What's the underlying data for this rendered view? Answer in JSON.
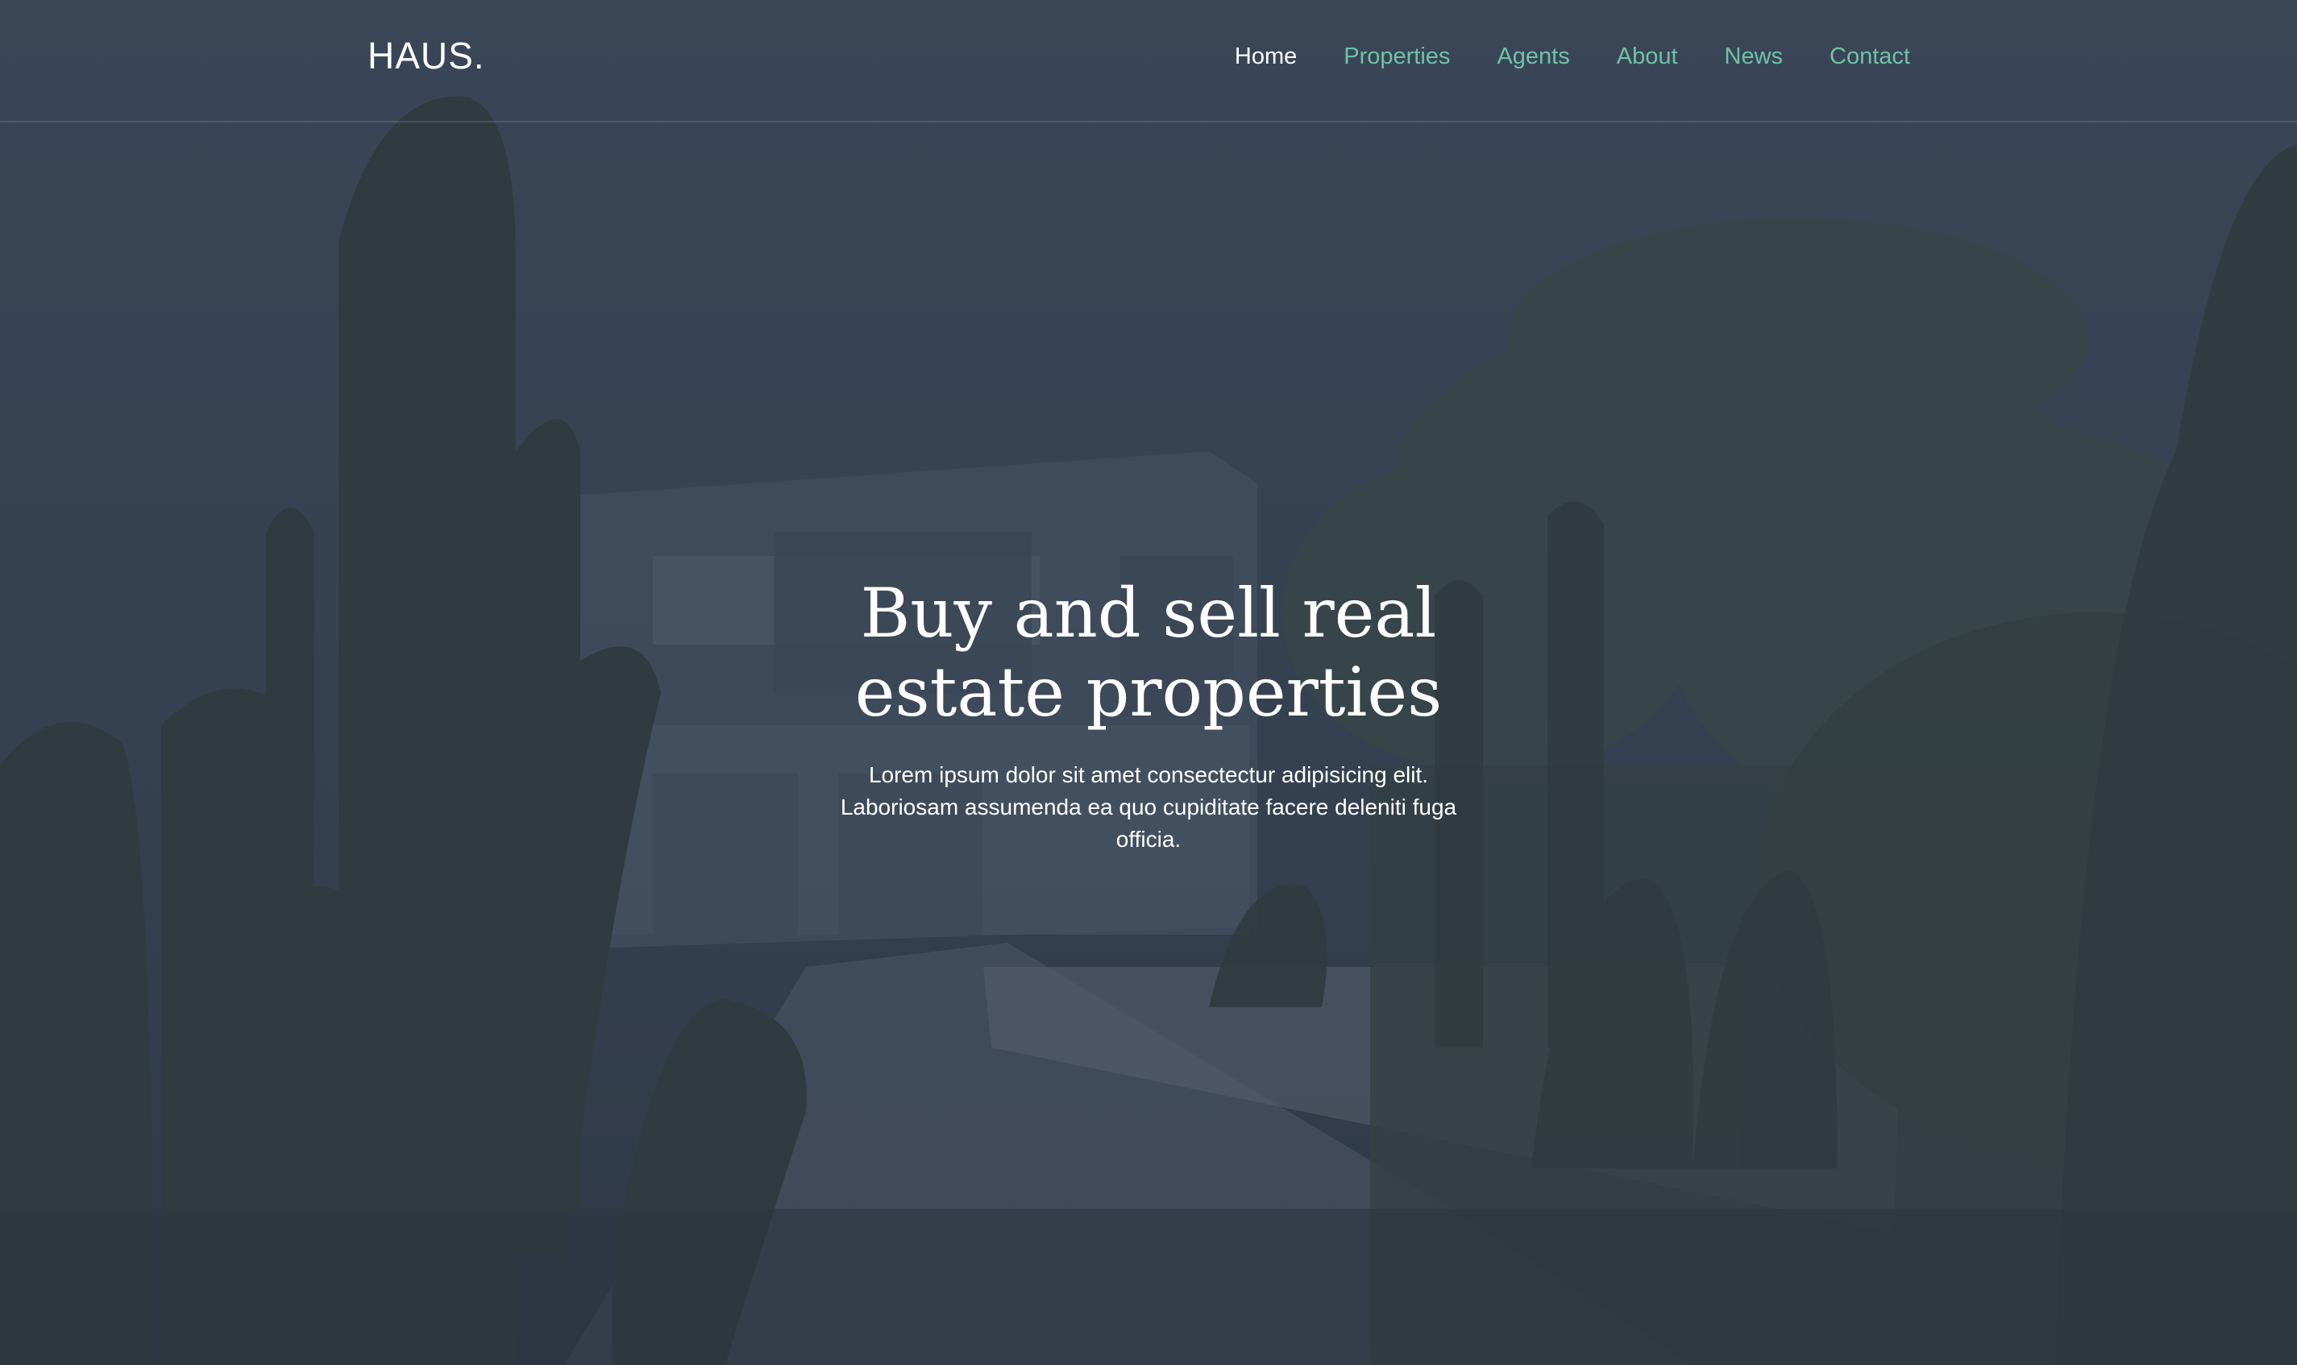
{
  "brand": {
    "logo_text": "HAUS."
  },
  "nav": {
    "items": [
      {
        "label": "Home",
        "active": true
      },
      {
        "label": "Properties",
        "active": false
      },
      {
        "label": "Agents",
        "active": false
      },
      {
        "label": "About",
        "active": false
      },
      {
        "label": "News",
        "active": false
      },
      {
        "label": "Contact",
        "active": false
      }
    ]
  },
  "hero": {
    "title_line1": "Buy and sell real",
    "title_line2": "estate properties",
    "subtitle": "Lorem ipsum dolor sit amet consectectur adipisicing elit. Laboriosam assumenda ea quo cupiditate facere deleniti fuga officia."
  },
  "colors": {
    "accent": "#6fc1a8",
    "overlay": "#343f50",
    "text": "#ffffff"
  }
}
